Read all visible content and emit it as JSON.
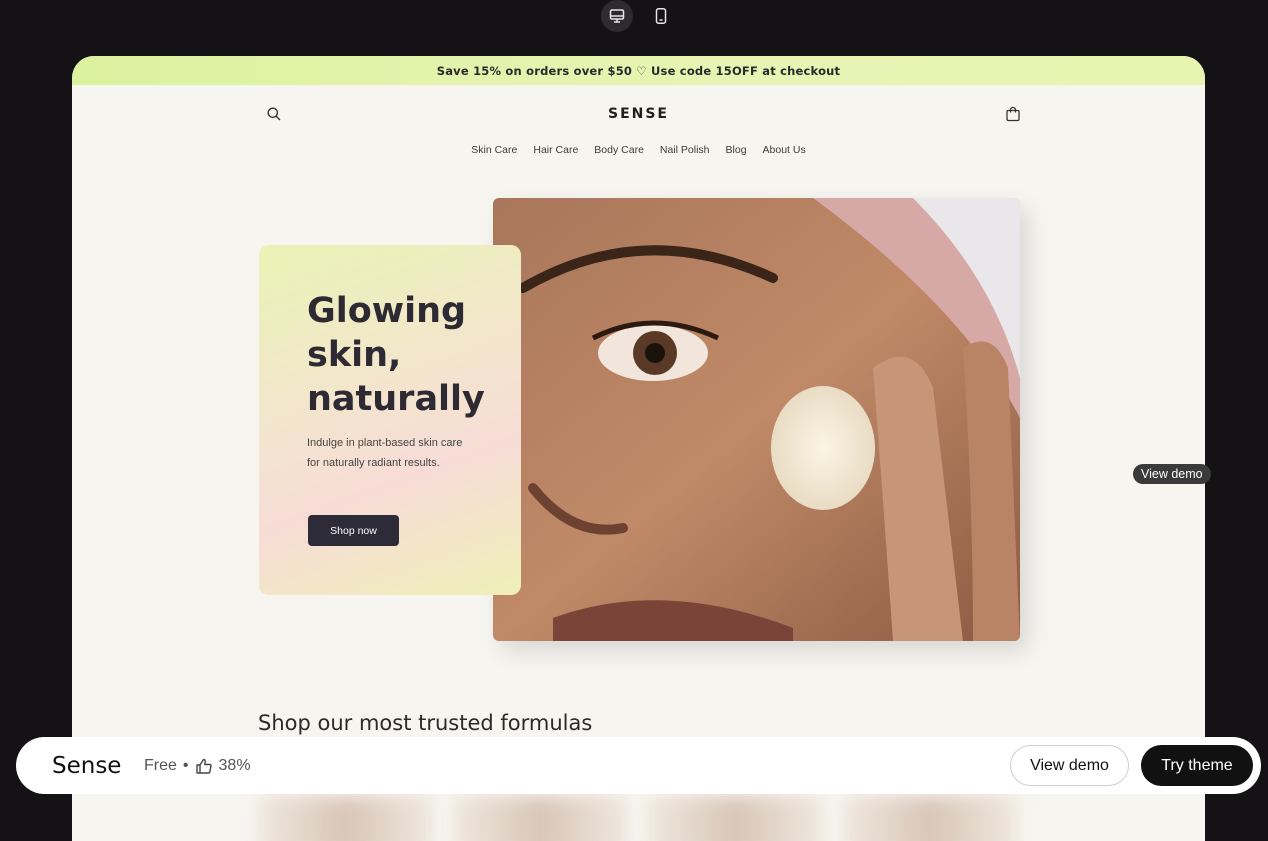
{
  "toolbar": {
    "desktop_icon": "monitor-icon",
    "mobile_icon": "mobile-icon"
  },
  "store": {
    "announcement": "Save 15% on orders over $50 ♡ Use code 15OFF at checkout",
    "logo": "SENSE",
    "nav": [
      "Skin Care",
      "Hair Care",
      "Body Care",
      "Nail Polish",
      "Blog",
      "About Us"
    ],
    "hero": {
      "title_lines": [
        "Glowing",
        "skin,",
        "naturally"
      ],
      "subtitle": "Indulge in plant-based skin care for naturally radiant results.",
      "button": "Shop now"
    },
    "section_title": "Shop our most trusted formulas"
  },
  "floating": {
    "view_demo": "View demo"
  },
  "bottom_bar": {
    "theme_name": "Sense",
    "price": "Free",
    "separator": "•",
    "rating": "38%",
    "view_demo": "View demo",
    "try_theme": "Try theme"
  },
  "colors": {
    "background": "#141214",
    "announcement": "#dbf2a0",
    "hero_button": "#2d2b38",
    "primary_button": "#111111"
  }
}
